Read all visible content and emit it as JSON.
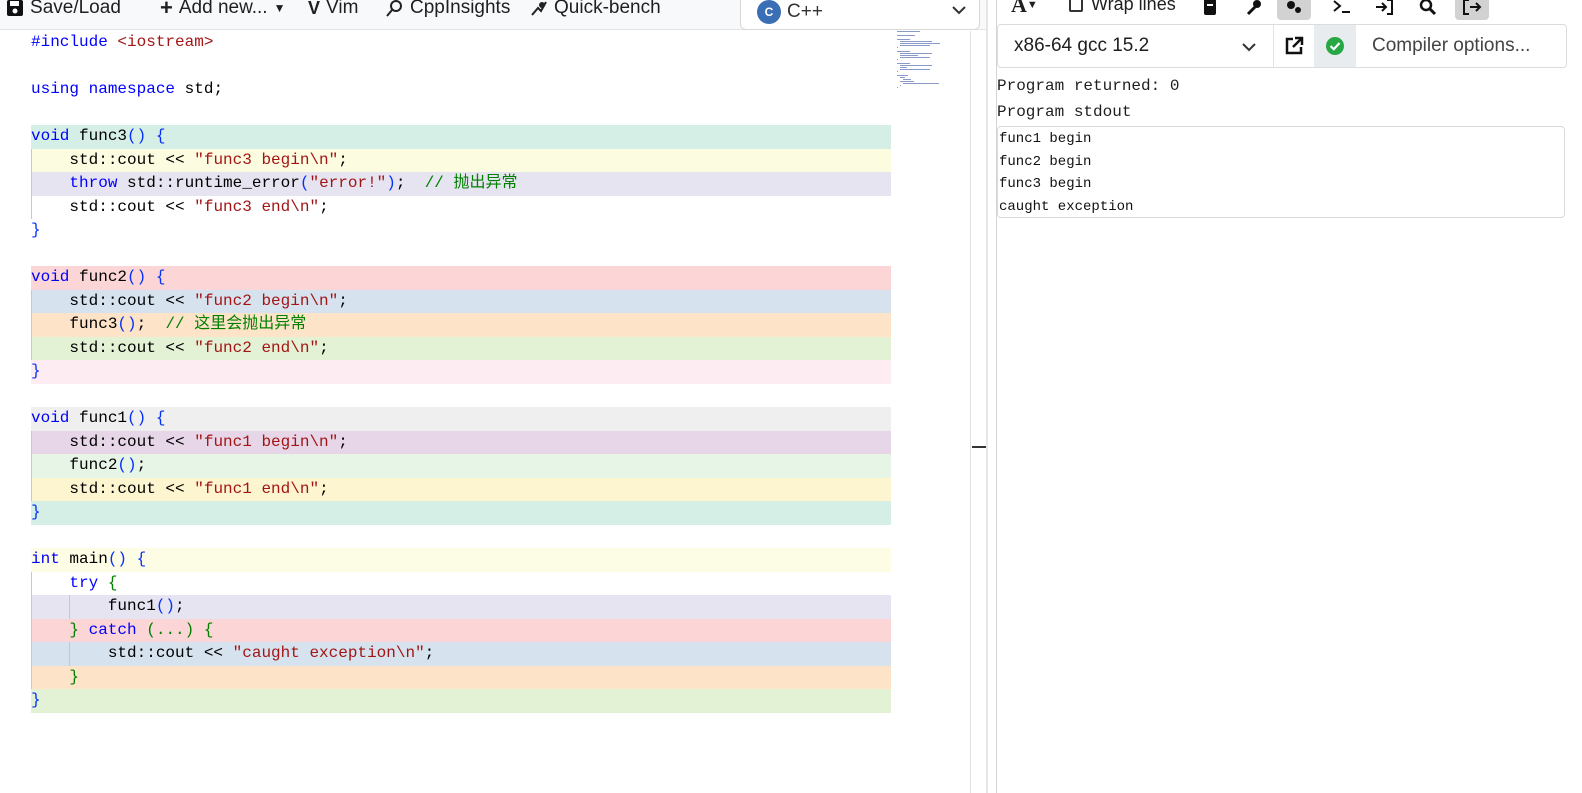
{
  "editor_toolbar": {
    "save_load": "Save/Load",
    "add_new": "Add new...",
    "vim": "Vim",
    "cppinsights": "CppInsights",
    "quickbench": "Quick-bench",
    "language": "C++"
  },
  "code_lines": [
    {
      "html": "<span class='pp'>#include</span> <span class='str'>&lt;iostream&gt;</span>",
      "bg": "transparent"
    },
    {
      "html": "",
      "bg": "transparent"
    },
    {
      "html": "<span class='kw'>using namespace</span> std;",
      "bg": "transparent"
    },
    {
      "html": "",
      "bg": "transparent"
    },
    {
      "html": "<span class='kw'>void</span> func3<span class='br'>()</span> <span class='br'>{</span>",
      "bg": "#d5efe6"
    },
    {
      "html": "    std::cout &lt;&lt; <span class='str'>\"func3 begin\\n\"</span>;",
      "bg": "#fcfde0"
    },
    {
      "html": "    <span class='kw'>throw</span> std::runtime_error<span class='br'>(</span><span class='str'>\"error!\"</span><span class='br'>)</span>;  <span class='cm'>// 抛出异常</span>",
      "bg": "#e6e4f0"
    },
    {
      "html": "    std::cout &lt;&lt; <span class='str'>\"func3 end\\n\"</span>;",
      "bg": "transparent"
    },
    {
      "html": "<span class='br'>}</span>",
      "bg": "transparent"
    },
    {
      "html": "",
      "bg": "transparent"
    },
    {
      "html": "<span class='kw'>void</span> func2<span class='br'>()</span> <span class='br'>{</span>",
      "bg": "#fcd6d6"
    },
    {
      "html": "    std::cout &lt;&lt; <span class='str'>\"func2 begin\\n\"</span>;",
      "bg": "#d6e3ef"
    },
    {
      "html": "    func3<span class='br'>()</span>;  <span class='cm'>// 这里会抛出异常</span>",
      "bg": "#fde3c8"
    },
    {
      "html": "    std::cout &lt;&lt; <span class='str'>\"func2 end\\n\"</span>;",
      "bg": "#e3f1d4"
    },
    {
      "html": "<span class='br'>}</span>",
      "bg": "#fdecf2"
    },
    {
      "html": "",
      "bg": "transparent"
    },
    {
      "html": "<span class='kw'>void</span> func1<span class='br'>()</span> <span class='br'>{</span>",
      "bg": "#efefef"
    },
    {
      "html": "    std::cout &lt;&lt; <span class='str'>\"func1 begin\\n\"</span>;",
      "bg": "#e6d6e8"
    },
    {
      "html": "    func2<span class='br'>()</span>;",
      "bg": "#e7f5e6"
    },
    {
      "html": "    std::cout &lt;&lt; <span class='str'>\"func1 end\\n\"</span>;",
      "bg": "#fdf5cf"
    },
    {
      "html": "<span class='br'>}</span>",
      "bg": "#d5efe6"
    },
    {
      "html": "",
      "bg": "transparent"
    },
    {
      "html": "<span class='kw'>int</span> main<span class='br'>()</span> <span class='br'>{</span>",
      "bg": "#fdfde6"
    },
    {
      "html": "    <span class='kw'>try</span> <span class='cm'>{</span>",
      "bg": "transparent"
    },
    {
      "html": "        func1<span class='br'>()</span>;",
      "bg": "#e6e4f0"
    },
    {
      "html": "    <span class='cm'>}</span> <span class='kw'>catch</span> <span class='cm'>(...)</span> <span class='cm'>{</span>",
      "bg": "#fcd6d6"
    },
    {
      "html": "        std::cout &lt;&lt; <span class='str'>\"caught exception\\n\"</span>;",
      "bg": "#d6e3ef"
    },
    {
      "html": "    <span class='cm'>}</span>",
      "bg": "#fde3c8"
    },
    {
      "html": "<span class='br'>}</span>",
      "bg": "#e3f1d4"
    }
  ],
  "exec_toolbar": {
    "font_icon": "A",
    "wrap_lines": "Wrap lines"
  },
  "compiler": {
    "name": "x86-64 gcc 15.2",
    "options_placeholder": "Compiler options..."
  },
  "output": {
    "returned": "Program returned: 0",
    "stdout_label": "Program stdout",
    "stdout_lines": [
      "func1 begin",
      "func2 begin",
      "func3 begin",
      "caught exception"
    ]
  },
  "colors": {
    "keyword": "#0000ff",
    "string": "#a31515",
    "comment": "#008000",
    "status_ok": "#28a745"
  }
}
